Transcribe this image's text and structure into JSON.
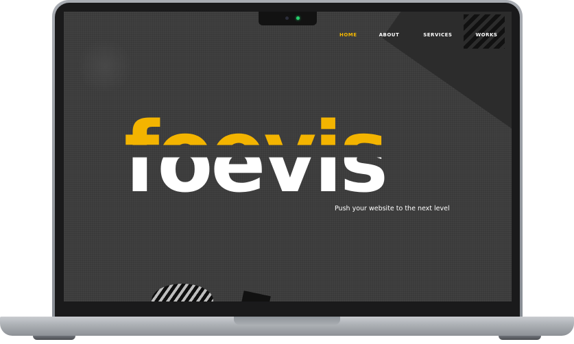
{
  "nav": {
    "items": [
      {
        "label": "HOME",
        "active": true
      },
      {
        "label": "ABOUT",
        "active": false
      },
      {
        "label": "SERVICES",
        "active": false
      },
      {
        "label": "WORKS",
        "active": false
      }
    ]
  },
  "hero": {
    "logo_text": "foevis",
    "tagline": "Push your website to the next level"
  },
  "colors": {
    "accent": "#f3b400",
    "screen_background": "#3a3a3a",
    "text": "#ffffff",
    "camera_led": "#27d06d"
  }
}
